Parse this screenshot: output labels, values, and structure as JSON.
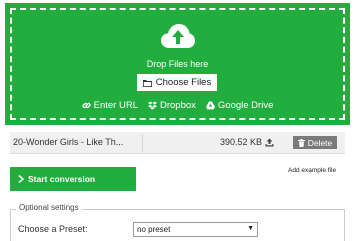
{
  "dropzone": {
    "drop_text": "Drop Files here",
    "choose_label": "Choose Files",
    "sources": [
      {
        "label": "Enter URL",
        "icon": "link-icon"
      },
      {
        "label": "Dropbox",
        "icon": "dropbox-icon"
      },
      {
        "label": "Google Drive",
        "icon": "google-drive-icon"
      }
    ]
  },
  "file": {
    "name": "20-Wonder Girls - Like Th...",
    "size": "390.52 KB",
    "delete_label": "Delete"
  },
  "actions": {
    "start_label": "Start conversion",
    "example_label": "Add example file"
  },
  "settings": {
    "legend": "Optional settings",
    "preset_label": "Choose a Preset:",
    "preset_value": "no preset"
  },
  "colors": {
    "accent": "#22ad3f",
    "delete_bg": "#7a7a7a"
  }
}
